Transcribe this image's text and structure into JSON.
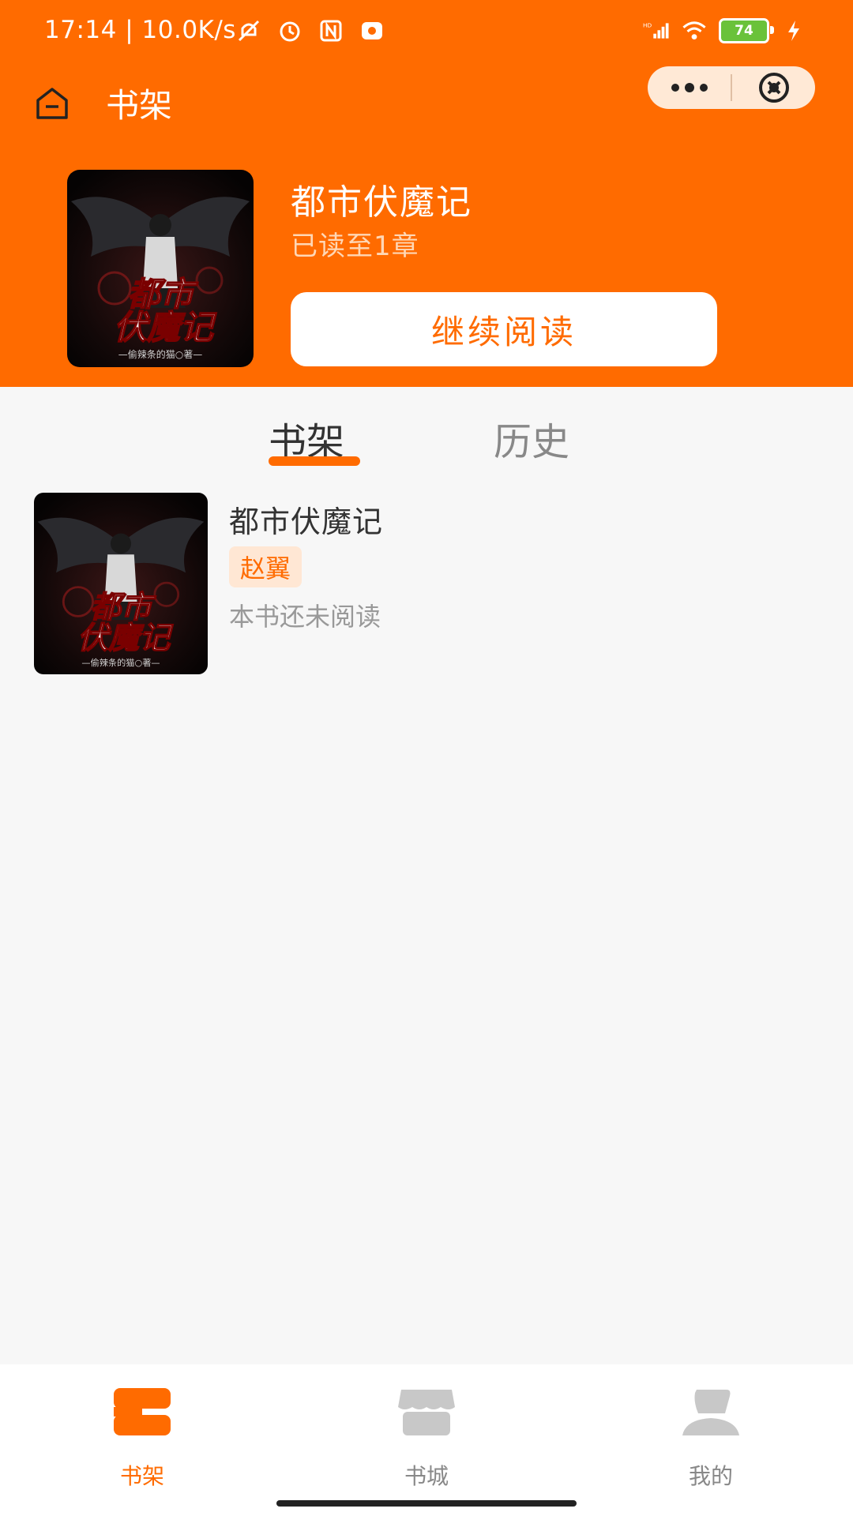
{
  "status_bar": {
    "time": "17:14",
    "network_speed": "10.0K/s",
    "battery_level": "74",
    "icons": [
      "mute-icon",
      "alarm-icon",
      "nfc-icon",
      "camera-app-icon",
      "hd-signal-icon",
      "wifi-icon",
      "battery-icon",
      "charging-icon"
    ]
  },
  "nav": {
    "title": "书架"
  },
  "hero": {
    "book_title": "都市伏魔记",
    "progress": "已读至1章",
    "continue_label": "继续阅读"
  },
  "cover": {
    "title_line1": "都市",
    "title_line2": "伏魔记",
    "author_line": "—偷辣条的猫○著—"
  },
  "tabs": [
    {
      "label": "书架",
      "active": true
    },
    {
      "label": "历史",
      "active": false
    }
  ],
  "shelf": {
    "items": [
      {
        "title": "都市伏魔记",
        "author": "赵翼",
        "status": "本书还未阅读"
      }
    ]
  },
  "bottom_nav": [
    {
      "label": "书架",
      "icon": "bookshelf-icon",
      "active": true
    },
    {
      "label": "书城",
      "icon": "store-icon",
      "active": false
    },
    {
      "label": "我的",
      "icon": "profile-icon",
      "active": false
    }
  ],
  "colors": {
    "accent": "#ff6b00",
    "tag_bg": "#ffe7d4",
    "inactive": "#c8c8c8"
  }
}
